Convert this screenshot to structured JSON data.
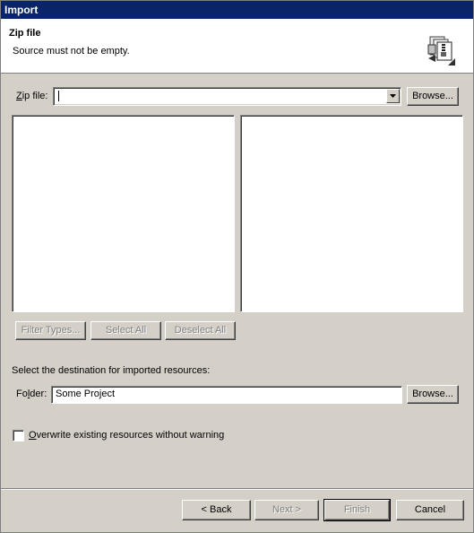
{
  "window": {
    "title": "Import"
  },
  "banner": {
    "title": "Zip file",
    "message": "Source must not be empty.",
    "icon": "zip-archive-icon"
  },
  "source": {
    "label_prefix": "Z",
    "label_rest": "ip file:",
    "value": "",
    "browse_label": "Browse..."
  },
  "buttons_row": {
    "filter_types": "Filter Types...",
    "select_all": "Select All",
    "deselect_all": "Deselect All"
  },
  "destination": {
    "heading": "Select the destination for imported resources:",
    "folder_label_prefix": "Fo",
    "folder_label_u": "l",
    "folder_label_rest": "der:",
    "folder_value": "Some Project",
    "browse_label": "Browse..."
  },
  "options": {
    "overwrite_label_u": "O",
    "overwrite_label_rest": "verwrite existing resources without warning",
    "overwrite_checked": false
  },
  "footer": {
    "back_label": "< Back",
    "next_label": "Next >",
    "finish_label": "Finish",
    "cancel_label": "Cancel"
  }
}
